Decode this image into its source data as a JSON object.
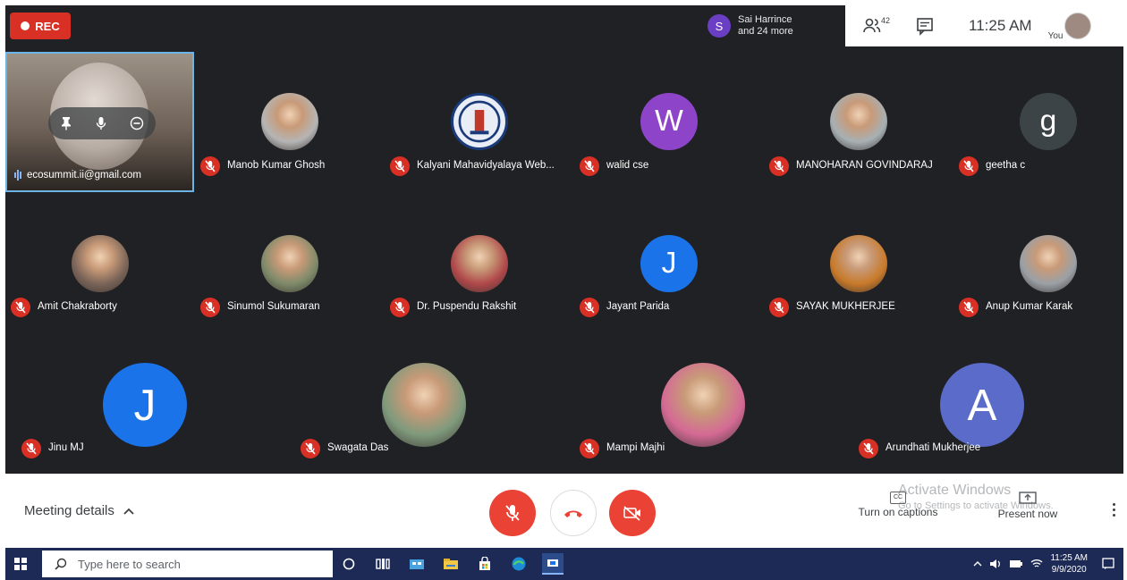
{
  "recording": {
    "label": "REC"
  },
  "presence": {
    "avatar_letter": "S",
    "line1": "Sai Harrince",
    "line2": "and 24 more"
  },
  "topbar": {
    "participant_count": "42",
    "clock": "11:25 AM",
    "you_label": "You"
  },
  "self_view": {
    "email": "ecosummit.ii@gmail.com"
  },
  "participants": [
    {
      "name": "Manob Kumar Ghosh",
      "avatar": "photo",
      "color": "#b5b5b5"
    },
    {
      "name": "Kalyani Mahavidyalaya Web...",
      "avatar": "logo",
      "color": "#e9eef6"
    },
    {
      "name": "walid cse",
      "avatar": "W",
      "color": "#8e44c9"
    },
    {
      "name": "MANOHARAN GOVINDARAJ",
      "avatar": "photo",
      "color": "#a7b0b4"
    },
    {
      "name": "geetha c",
      "avatar": "g",
      "color": "#3c4448"
    },
    {
      "name": "Amit Chakraborty",
      "avatar": "photo",
      "color": "#7a6458"
    },
    {
      "name": "Sinumol Sukumaran",
      "avatar": "photo",
      "color": "#7d8a6a"
    },
    {
      "name": "Dr. Puspendu Rakshit",
      "avatar": "photo",
      "color": "#b0484a"
    },
    {
      "name": "Jayant Parida",
      "avatar": "J",
      "color": "#1a73e8"
    },
    {
      "name": "SAYAK MUKHERJEE",
      "avatar": "photo",
      "color": "#c87a2a"
    },
    {
      "name": "Anup Kumar Karak",
      "avatar": "photo",
      "color": "#9aa0a6"
    },
    {
      "name": "Jinu MJ",
      "avatar": "J",
      "color": "#1a73e8"
    },
    {
      "name": "Swagata Das",
      "avatar": "photo",
      "color": "#7f9a7c"
    },
    {
      "name": "Mampi Majhi",
      "avatar": "photo",
      "color": "#d46a95"
    },
    {
      "name": "Arundhati Mukherjee",
      "avatar": "A",
      "color": "#5b6bc9"
    }
  ],
  "bottom": {
    "meeting_details": "Meeting details",
    "captions_label": "Turn on captions",
    "present_label": "Present now",
    "cc_text": "CC",
    "activate_title": "Activate Windows",
    "activate_sub": "Go to Settings to activate Windows."
  },
  "taskbar": {
    "search_placeholder": "Type here to search",
    "time": "11:25 AM",
    "date": "9/9/2020"
  },
  "colors": {
    "red": "#ea4335",
    "dark": "#202124",
    "taskbar": "#1c2a55",
    "accent_blue": "#1a73e8"
  }
}
